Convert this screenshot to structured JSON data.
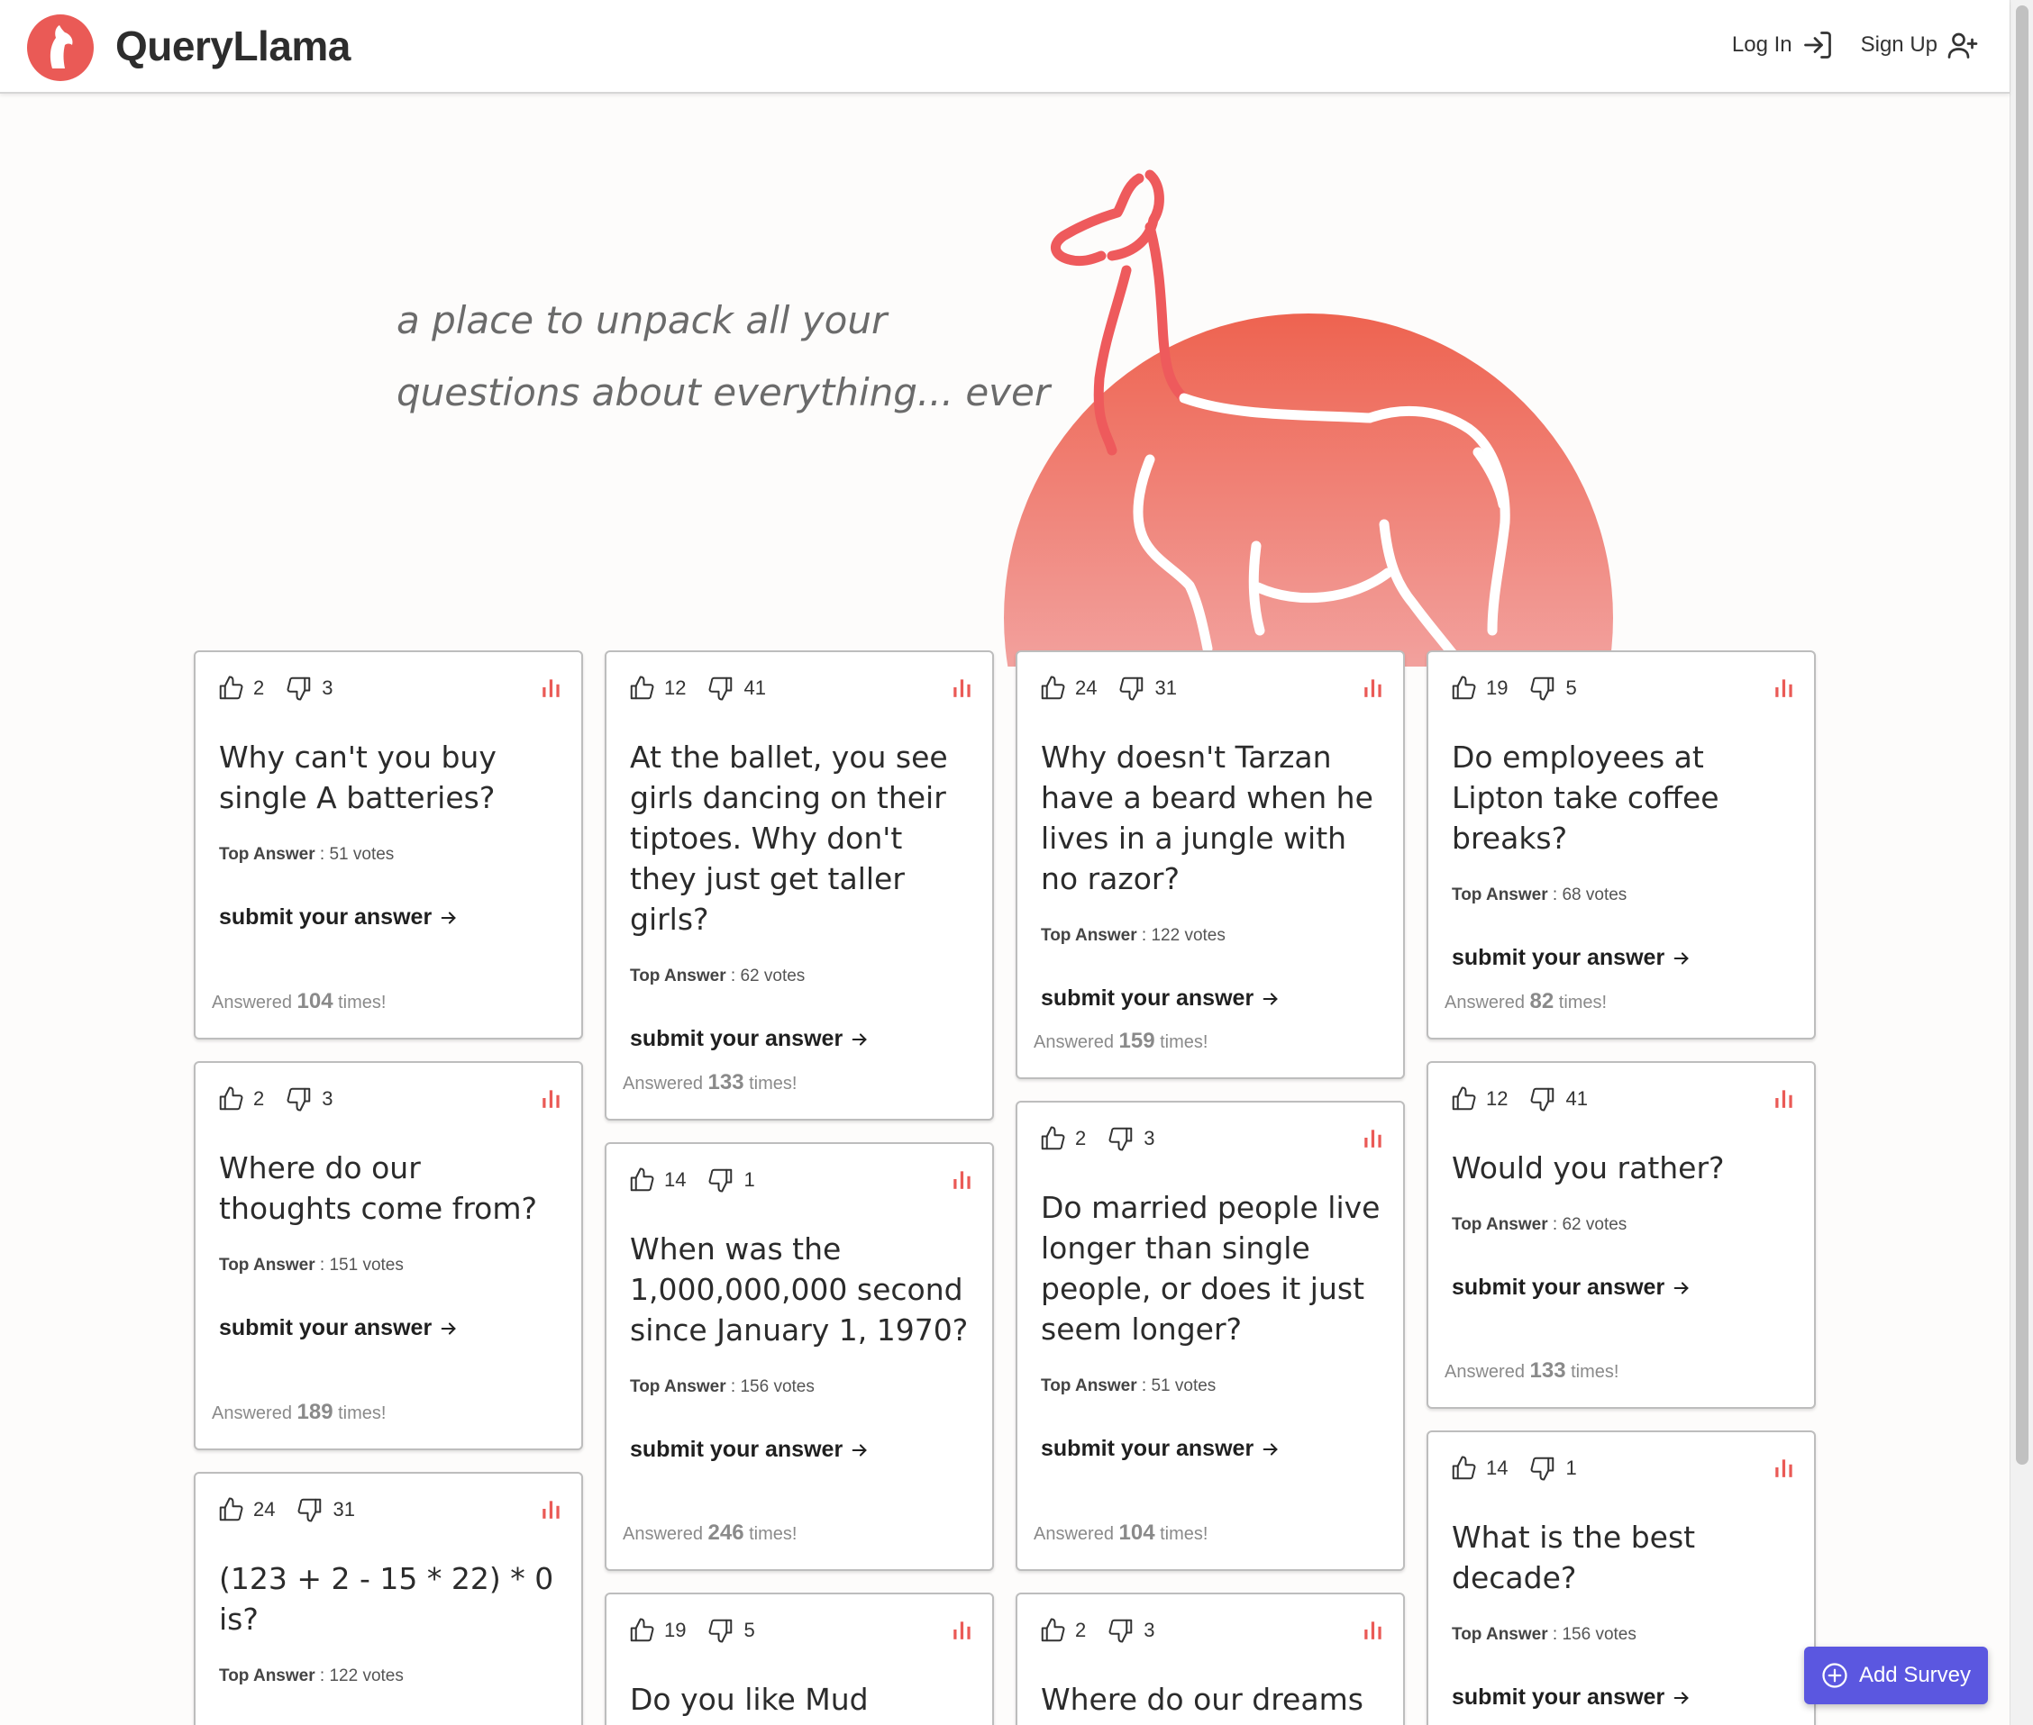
{
  "header": {
    "brand": "QueryLlama",
    "login_label": "Log In",
    "signup_label": "Sign Up"
  },
  "hero": {
    "line1": "a place to unpack all your",
    "line2": "questions about everything... ever"
  },
  "strings": {
    "top_answer_label": "Top Answer",
    "submit_label": "submit your answer",
    "answered_prefix": "Answered",
    "answered_suffix": "times!"
  },
  "cards": [
    {
      "likes": "2",
      "dislikes": "3",
      "question": "Why can't you buy single A batteries?",
      "top_votes": ": 51 votes",
      "answered": "104"
    },
    {
      "likes": "2",
      "dislikes": "3",
      "question": "Where do our thoughts come from?",
      "top_votes": ": 151 votes",
      "answered": "189"
    },
    {
      "likes": "24",
      "dislikes": "31",
      "question": "(123 + 2 - 15 * 22) * 0 is?",
      "top_votes": ": 122 votes",
      "answered": ""
    },
    {
      "likes": "12",
      "dislikes": "41",
      "question": "At the ballet, you see girls dancing on their tiptoes. Why don't they just get taller girls?",
      "top_votes": ": 62 votes",
      "answered": "133"
    },
    {
      "likes": "14",
      "dislikes": "1",
      "question": "When was the 1,000,000,000 second since January 1, 1970?",
      "top_votes": ": 156 votes",
      "answered": "246"
    },
    {
      "likes": "19",
      "dislikes": "5",
      "question": "Do you like Mud Water?",
      "top_votes": "",
      "answered": ""
    },
    {
      "likes": "24",
      "dislikes": "31",
      "question": "Why doesn't Tarzan have a beard when he lives in a jungle with no razor?",
      "top_votes": ": 122 votes",
      "answered": "159"
    },
    {
      "likes": "2",
      "dislikes": "3",
      "question": "Do married people live longer than single people, or does it just seem longer?",
      "top_votes": ": 51 votes",
      "answered": "104"
    },
    {
      "likes": "2",
      "dislikes": "3",
      "question": "Where do our dreams",
      "top_votes": "",
      "answered": ""
    },
    {
      "likes": "19",
      "dislikes": "5",
      "question": "Do employees at Lipton take coffee breaks?",
      "top_votes": ": 68 votes",
      "answered": "82"
    },
    {
      "likes": "12",
      "dislikes": "41",
      "question": "Would you rather?",
      "top_votes": ": 62 votes",
      "answered": "133"
    },
    {
      "likes": "14",
      "dislikes": "1",
      "question": "What is the best decade?",
      "top_votes": ": 156 votes",
      "answered": ""
    }
  ],
  "fab": {
    "label": "Add Survey"
  },
  "colors": {
    "brand_red": "#ea5a56",
    "accent_purple": "#5b57e0"
  }
}
